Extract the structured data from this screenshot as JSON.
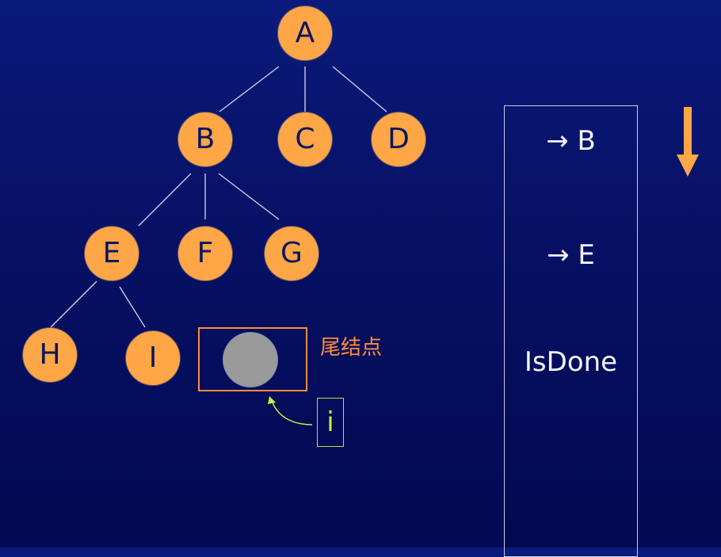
{
  "tree": {
    "nodes": [
      {
        "id": "A",
        "label": "A"
      },
      {
        "id": "B",
        "label": "B"
      },
      {
        "id": "C",
        "label": "C"
      },
      {
        "id": "D",
        "label": "D"
      },
      {
        "id": "E",
        "label": "E"
      },
      {
        "id": "F",
        "label": "F"
      },
      {
        "id": "G",
        "label": "G"
      },
      {
        "id": "H",
        "label": "H"
      },
      {
        "id": "I",
        "label": "I"
      }
    ],
    "edges": [
      [
        "A",
        "B"
      ],
      [
        "A",
        "C"
      ],
      [
        "A",
        "D"
      ],
      [
        "B",
        "E"
      ],
      [
        "B",
        "F"
      ],
      [
        "B",
        "G"
      ],
      [
        "E",
        "H"
      ],
      [
        "E",
        "I"
      ]
    ]
  },
  "tail": {
    "label": "尾结点"
  },
  "pointer": {
    "label": "i"
  },
  "stack": {
    "entries": [
      "→ B",
      "→ E",
      "IsDone"
    ]
  },
  "colors": {
    "background": "#071064",
    "node_fill": "#ffa646",
    "node_text": "#0b1660",
    "tail_node_fill": "#9a9a9a",
    "highlight_orange": "#ff8c3a",
    "pointer_green": "#c8ef3a",
    "edge_color": "#c7cce6",
    "panel_border": "#c7cce6",
    "arrow_color": "#ffa646"
  },
  "icons": {
    "direction": "arrow-down-icon"
  }
}
